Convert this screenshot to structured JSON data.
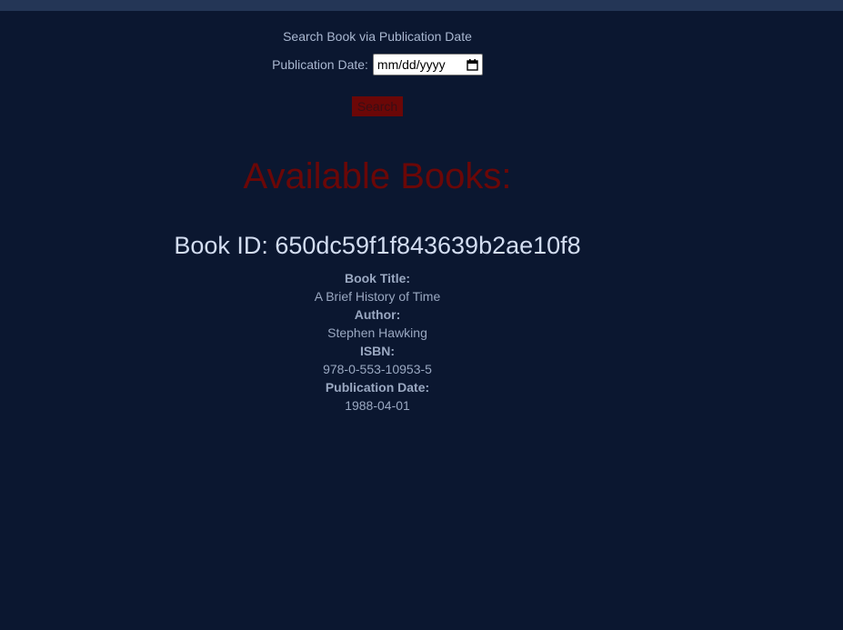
{
  "search": {
    "title": "Search Book via Publication Date",
    "date_label": "Publication Date:",
    "date_placeholder": "mm/dd/yyyy",
    "button_label": "Search"
  },
  "results": {
    "heading": "Available Books:",
    "book": {
      "id_text": "Book ID: 650dc59f1f843639b2ae10f8",
      "title_label": "Book Title:",
      "title": "A Brief History of Time",
      "author_label": "Author:",
      "author": "Stephen Hawking",
      "isbn_label": "ISBN:",
      "isbn": "978-0-553-10953-5",
      "pubdate_label": "Publication Date:",
      "pubdate": "1988-04-01"
    }
  },
  "icons": {
    "date_picker": "calendar-icon"
  },
  "colors": {
    "background": "#0b1730",
    "topbar": "#243656",
    "accent_red": "#6b0707",
    "heading_text": "#d3ddf1",
    "body_text": "#9aa8c1"
  }
}
